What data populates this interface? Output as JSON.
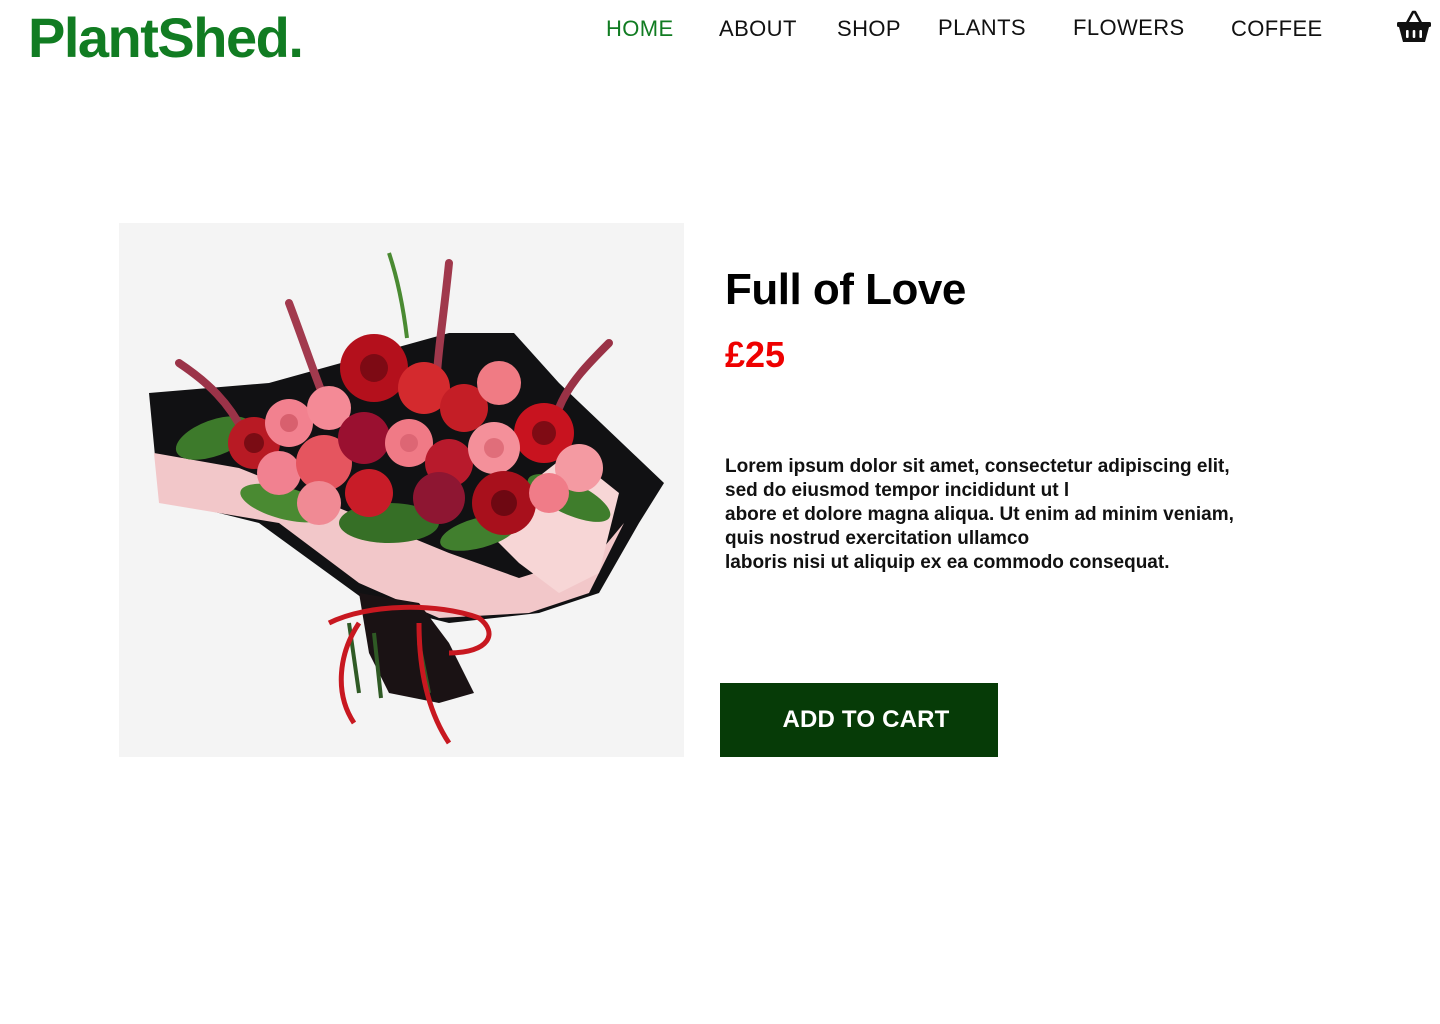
{
  "brand": {
    "name": "PlantShed.",
    "color": "#117c22"
  },
  "nav": {
    "items": [
      {
        "label": "HOME",
        "active": true
      },
      {
        "label": "ABOUT",
        "active": false
      },
      {
        "label": "SHOP",
        "active": false
      },
      {
        "label": "PLANTS",
        "active": false
      },
      {
        "label": "FLOWERS",
        "active": false
      },
      {
        "label": "COFFEE",
        "active": false
      }
    ],
    "cart_icon": "basket-icon"
  },
  "product": {
    "title": "Full of Love",
    "price": "£25",
    "price_color": "#ee0000",
    "image_icon": "flower-bouquet-image",
    "description_lines": [
      "Lorem ipsum dolor sit amet, consectetur adipiscing elit,",
      "sed do eiusmod tempor incididunt ut l",
      "abore et dolore magna aliqua. Ut enim ad minim veniam,",
      "quis nostrud exercitation ullamco",
      "laboris nisi ut aliquip ex ea commodo consequat."
    ],
    "add_to_cart_label": "ADD TO CART",
    "button_color": "#063b07"
  }
}
